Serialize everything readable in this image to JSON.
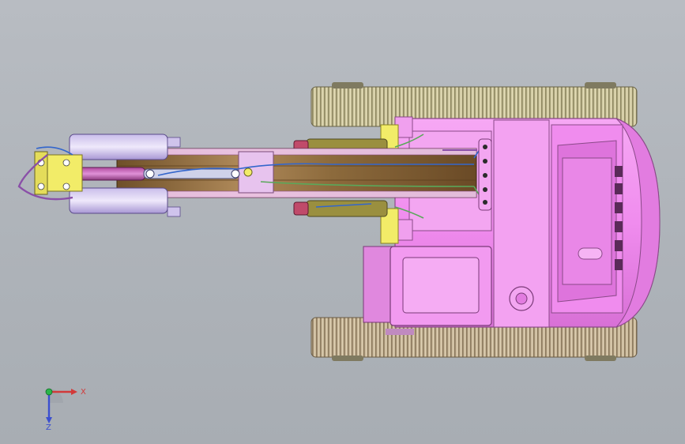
{
  "viewport": {
    "background_top": "#b8bcc2",
    "background_bottom": "#a8adb3"
  },
  "model": {
    "colors": {
      "body": "#f28ef0",
      "body_shadow": "#d66fd4",
      "body_light": "#f8b8f6",
      "track": "#c9c29a",
      "track_dark": "#a59d77",
      "arm": "#8a6a3a",
      "arm_light": "#b89262",
      "boom_plate": "#e7c3ee",
      "hydraulic": "#9a8f3f",
      "bucket": "#b7a6de",
      "pin_yellow": "#f2ec68",
      "cable_blue": "#3366cc",
      "cable_green": "#5aa85a",
      "cable_purple": "#8a4fa8"
    },
    "icons": [
      "coordinate-triad-icon"
    ]
  },
  "triad": {
    "x_label": "X",
    "z_label": "Z",
    "x_color": "#d23a3a",
    "y_color": "#2bb54a",
    "z_color": "#3b4fd0"
  }
}
